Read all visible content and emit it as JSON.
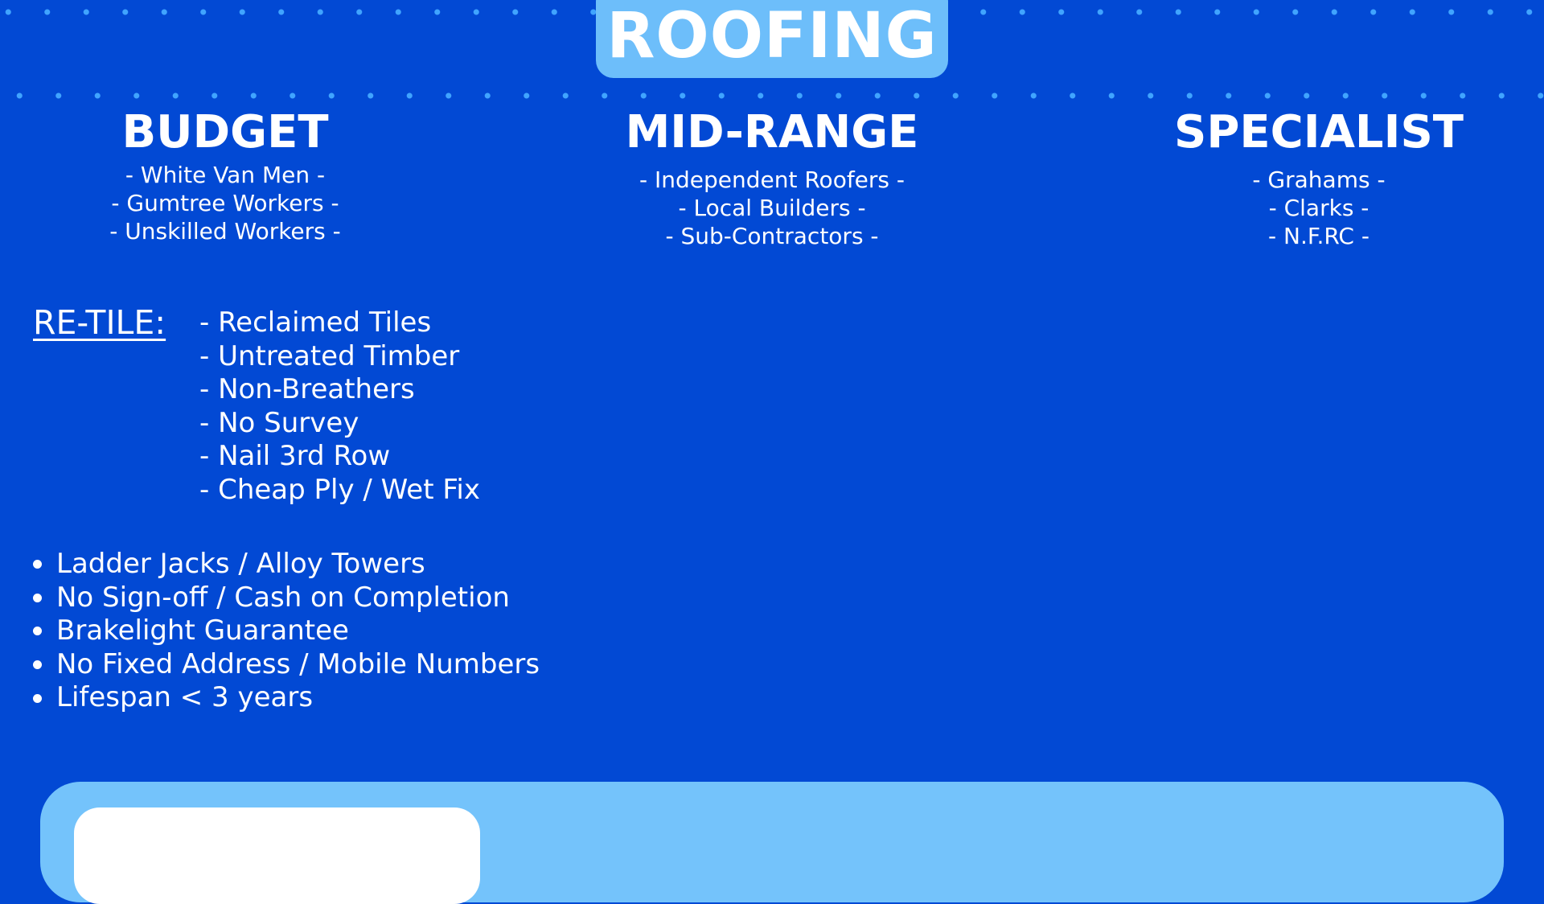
{
  "title": "ROOFING",
  "colors": {
    "background": "#0249D4",
    "accent": "#6DBEFA",
    "dots": "#40A4FF",
    "panel": "#74C3FB",
    "text": "#FFFFFF"
  },
  "columns": [
    {
      "heading": "BUDGET",
      "items": [
        "- White Van Men -",
        "- Gumtree Workers -",
        "- Unskilled Workers -"
      ]
    },
    {
      "heading": "MID-RANGE",
      "items": [
        "- Independent Roofers -",
        "- Local Builders -",
        "- Sub-Contractors -"
      ]
    },
    {
      "heading": "SPECIALIST",
      "items": [
        "- Grahams -",
        "- Clarks -",
        "- N.F.RC -"
      ]
    }
  ],
  "retile": {
    "label": "RE-TILE:",
    "items": [
      "- Reclaimed Tiles",
      "- Untreated Timber",
      "- Non-Breathers",
      "- No Survey",
      "- Nail 3rd Row",
      "- Cheap Ply / Wet Fix"
    ]
  },
  "bullets": [
    "Ladder Jacks / Alloy Towers",
    "No Sign-off / Cash on Completion",
    "Brakelight Guarantee",
    "No Fixed Address / Mobile Numbers",
    "Lifespan < 3 years"
  ]
}
